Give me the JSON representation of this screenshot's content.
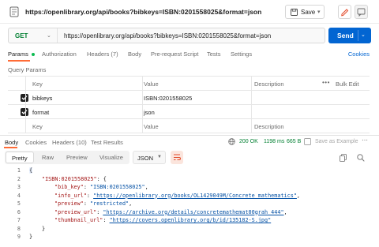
{
  "window": {
    "title": "https://openlibrary.org/api/books?bibkeys=ISBN:0201558025&format=json",
    "save_label": "Save"
  },
  "request": {
    "method": "GET",
    "url": "https://openlibrary.org/api/books?bibkeys=ISBN:0201558025&format=json",
    "send_label": "Send",
    "tabs": [
      {
        "label": "Params",
        "active": true
      },
      {
        "label": "Authorization"
      },
      {
        "label": "Headers (7)"
      },
      {
        "label": "Body"
      },
      {
        "label": "Pre-request Script"
      },
      {
        "label": "Tests"
      },
      {
        "label": "Settings"
      }
    ],
    "cookies_label": "Cookies"
  },
  "params": {
    "section_title": "Query Params",
    "headers": {
      "key": "Key",
      "value": "Value",
      "description": "Description",
      "bulk_edit": "Bulk Edit"
    },
    "rows": [
      {
        "key": "bibkeys",
        "value": "ISBN:0201558025",
        "checked": true
      },
      {
        "key": "format",
        "value": "json",
        "checked": true
      }
    ],
    "placeholder": {
      "key": "Key",
      "value": "Value",
      "description": "Description"
    }
  },
  "response": {
    "tabs": [
      {
        "label": "Body",
        "active": true
      },
      {
        "label": "Cookies"
      },
      {
        "label": "Headers (10)"
      },
      {
        "label": "Test Results"
      }
    ],
    "status": "200 OK",
    "time": "1198 ms",
    "size": "665 B",
    "save_example": "Save as Example",
    "views": [
      {
        "label": "Pretty",
        "active": true
      },
      {
        "label": "Raw"
      },
      {
        "label": "Preview"
      },
      {
        "label": "Visualize"
      }
    ],
    "format": "JSON"
  },
  "code": {
    "lines": [
      {
        "num": "1",
        "text": "{"
      },
      {
        "num": "2",
        "key": "\"ISBN:0201558025\"",
        "rest": ": {"
      },
      {
        "num": "3",
        "key": "\"bib_key\"",
        "value": "\"ISBN:0201558025\"",
        "link": false
      },
      {
        "num": "4",
        "key": "\"info_url\"",
        "value": "\"https://openlibrary.org/books/OL1429049M/Concrete_mathematics\"",
        "link": true
      },
      {
        "num": "5",
        "key": "\"preview\"",
        "value": "\"restricted\"",
        "link": false
      },
      {
        "num": "6",
        "key": "\"preview_url\"",
        "value": "\"https://archive.org/details/concretemathemat00grah_444\"",
        "link": true
      },
      {
        "num": "7",
        "key": "\"thumbnail_url\"",
        "value": "\"https://covers.openlibrary.org/b/id/135182-S.jpg\"",
        "link": true
      },
      {
        "num": "8",
        "text": "}"
      },
      {
        "num": "9",
        "text": "}"
      }
    ]
  },
  "colors": {
    "accent": "#ff6c37",
    "send": "#0265d2",
    "status_ok": "#007f31"
  }
}
